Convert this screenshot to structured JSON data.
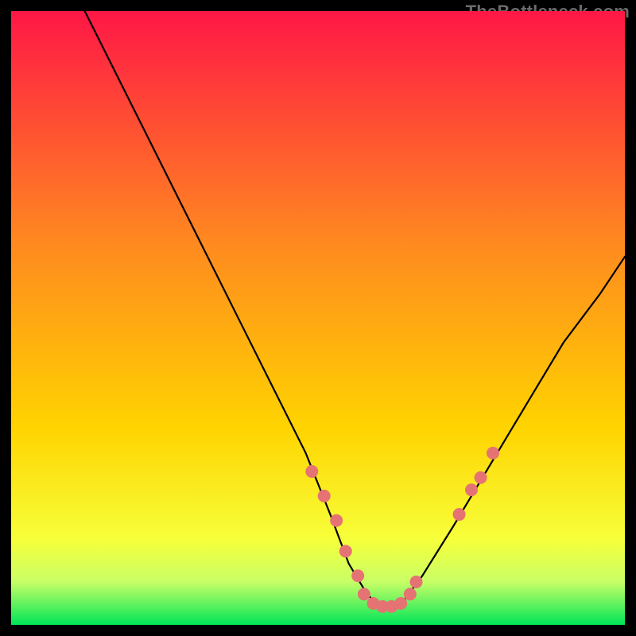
{
  "watermark": "TheBottleneck.com",
  "chart_data": {
    "type": "line",
    "title": "",
    "xlabel": "",
    "ylabel": "",
    "xlim": [
      0,
      100
    ],
    "ylim": [
      0,
      100
    ],
    "grid": false,
    "legend": false,
    "background_gradient": {
      "top": "#ff1746",
      "mid": "#ffd400",
      "bottom": "#00e658"
    },
    "curve": {
      "x": [
        12,
        18,
        24,
        30,
        36,
        42,
        48,
        52,
        55,
        58,
        60,
        62,
        64,
        67,
        72,
        78,
        84,
        90,
        96,
        100
      ],
      "y": [
        100,
        88,
        76,
        64,
        52,
        40,
        28,
        18,
        10,
        5,
        3,
        3,
        4,
        8,
        16,
        26,
        36,
        46,
        54,
        60
      ]
    },
    "markers": {
      "color": "#e57373",
      "radius_px": 8,
      "points": [
        {
          "x": 49,
          "y": 25
        },
        {
          "x": 51,
          "y": 21
        },
        {
          "x": 53,
          "y": 17
        },
        {
          "x": 54.5,
          "y": 12
        },
        {
          "x": 56.5,
          "y": 8
        },
        {
          "x": 57.5,
          "y": 5
        },
        {
          "x": 59,
          "y": 3.5
        },
        {
          "x": 60.5,
          "y": 3
        },
        {
          "x": 62,
          "y": 3
        },
        {
          "x": 63.5,
          "y": 3.5
        },
        {
          "x": 65,
          "y": 5
        },
        {
          "x": 66,
          "y": 7
        },
        {
          "x": 73,
          "y": 18
        },
        {
          "x": 75,
          "y": 22
        },
        {
          "x": 76.5,
          "y": 24
        },
        {
          "x": 78.5,
          "y": 28
        }
      ]
    }
  }
}
